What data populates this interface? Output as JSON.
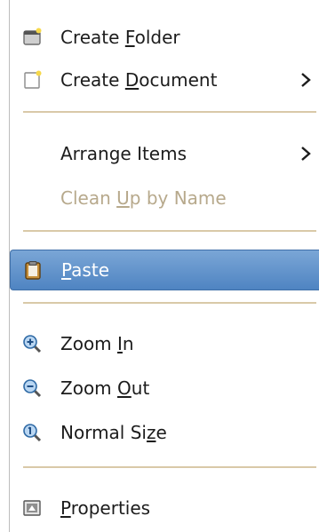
{
  "menu": {
    "items": [
      {
        "pre": "Create ",
        "mn": "F",
        "post": "older",
        "icon": "folder-new-icon",
        "submenu": false
      },
      {
        "pre": "Create ",
        "mn": "D",
        "post": "ocument",
        "icon": "document-new-icon",
        "submenu": true
      },
      {
        "pre": "Arrange Items",
        "mn": "",
        "post": "",
        "icon": "",
        "submenu": true
      },
      {
        "pre": "Clean ",
        "mn": "U",
        "post": "p by Name",
        "icon": "",
        "submenu": false,
        "disabled": true
      },
      {
        "pre": "",
        "mn": "P",
        "post": "aste",
        "icon": "clipboard-paste-icon",
        "submenu": false,
        "selected": true
      },
      {
        "pre": "Zoom ",
        "mn": "I",
        "post": "n",
        "icon": "zoom-in-icon",
        "submenu": false
      },
      {
        "pre": "Zoom ",
        "mn": "O",
        "post": "ut",
        "icon": "zoom-out-icon",
        "submenu": false
      },
      {
        "pre": "Normal Si",
        "mn": "z",
        "post": "e",
        "icon": "zoom-normal-icon",
        "submenu": false
      },
      {
        "pre": "",
        "mn": "P",
        "post": "roperties",
        "icon": "properties-icon",
        "submenu": false
      }
    ]
  },
  "colors": {
    "selection": "#4f84c2",
    "separator": "#d9c9a8",
    "disabled_text": "#b7a98c"
  }
}
